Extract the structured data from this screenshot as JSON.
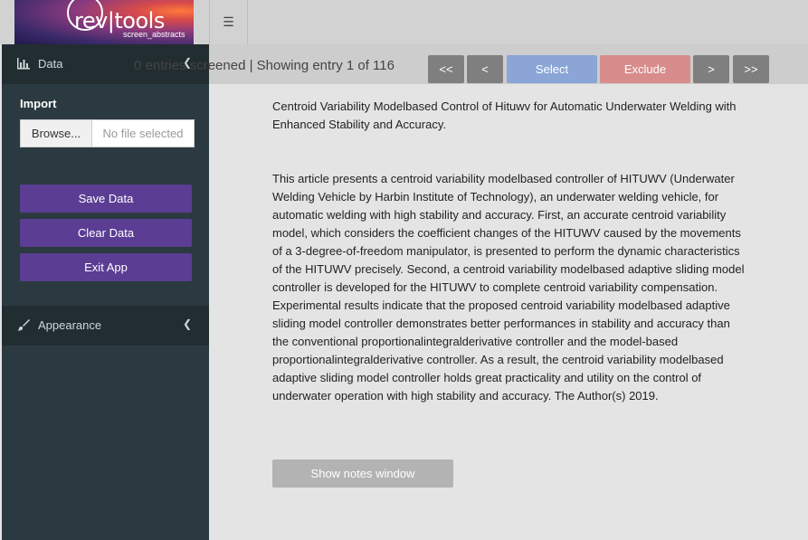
{
  "logo": {
    "brand": "rev|tools",
    "sub": "screen_abstracts"
  },
  "status_text": "0 entries screened | Showing entry 1 of 116",
  "nav": {
    "first": "<<",
    "prev": "<",
    "select": "Select",
    "exclude": "Exclude",
    "next": ">",
    "last": ">>"
  },
  "sidebar": {
    "data_label": "Data",
    "import_label": "Import",
    "browse_label": "Browse...",
    "file_placeholder": "No file selected",
    "save_label": "Save Data",
    "clear_label": "Clear Data",
    "exit_label": "Exit App",
    "appearance_label": "Appearance"
  },
  "entry": {
    "title": "Centroid Variability Modelbased Control of Hituwv for Automatic Underwater Welding with Enhanced Stability and Accuracy.",
    "abstract": "This article presents a centroid variability modelbased controller of HITUWV (Underwater Welding Vehicle by Harbin Institute of Technology), an underwater welding vehicle, for automatic welding with high stability and accuracy. First, an accurate centroid variability model, which considers the coefficient changes of the HITUWV caused by the movements of a 3-degree-of-freedom manipulator, is presented to perform the dynamic characteristics of the HITUWV precisely. Second, a centroid variability modelbased adaptive sliding model controller is developed for the HITUWV to complete centroid variability compensation. Experimental results indicate that the proposed centroid variability modelbased adaptive sliding model controller demonstrates better performances in stability and accuracy than the conventional proportionalintegralderivative controller and the model-based proportionalintegralderivative controller. As a result, the centroid variability modelbased adaptive sliding model controller holds great practicality and utility on the control of underwater operation with high stability and accuracy. The Author(s) 2019."
  },
  "notes_button": "Show notes window",
  "colors": {
    "sidebar_bg": "#2b3a40",
    "sidebar_header_bg": "#222d32",
    "button_purple": "#5b3d94",
    "select_blue": "#8aa5d6",
    "exclude_red": "#d98c8c",
    "nav_gray": "#7f7f7f"
  }
}
